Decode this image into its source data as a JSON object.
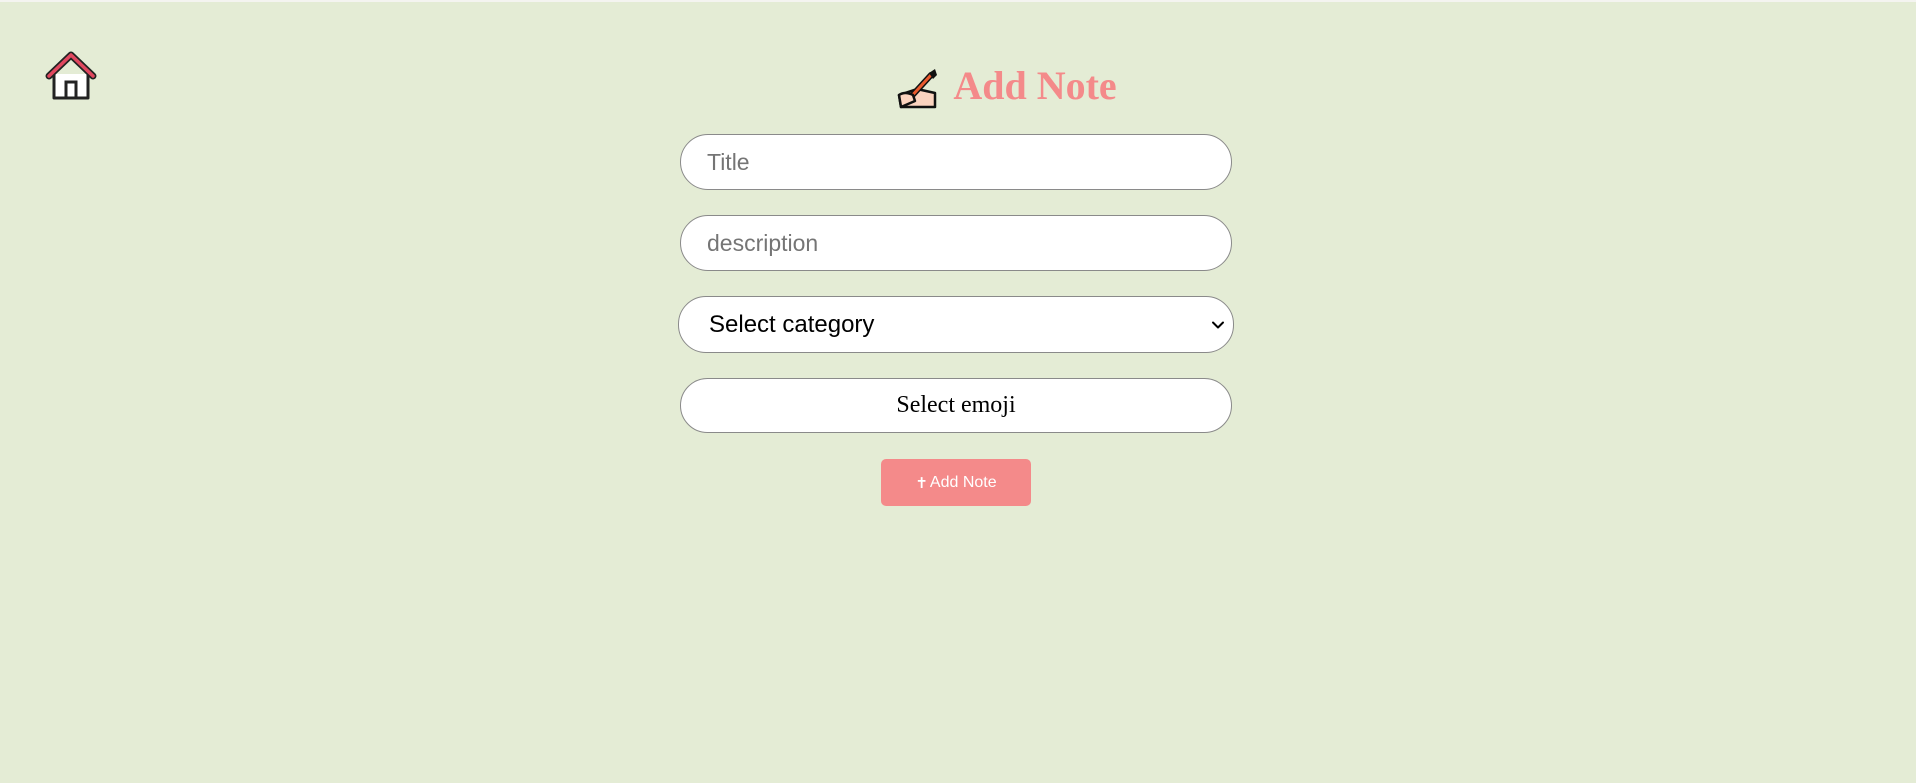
{
  "nav": {
    "home_icon": "home-icon"
  },
  "header": {
    "title": "Add Note",
    "icon": "writing-hand-icon"
  },
  "form": {
    "title_placeholder": "Title",
    "title_value": "",
    "description_placeholder": "description",
    "description_value": "",
    "category_selected": "Select category",
    "emoji_label": "Select emoji",
    "submit_icon": "✝",
    "submit_label": "Add Note"
  },
  "colors": {
    "background": "#e4ecd5",
    "accent": "#f48a8a",
    "home_roof": "#e0475f"
  }
}
